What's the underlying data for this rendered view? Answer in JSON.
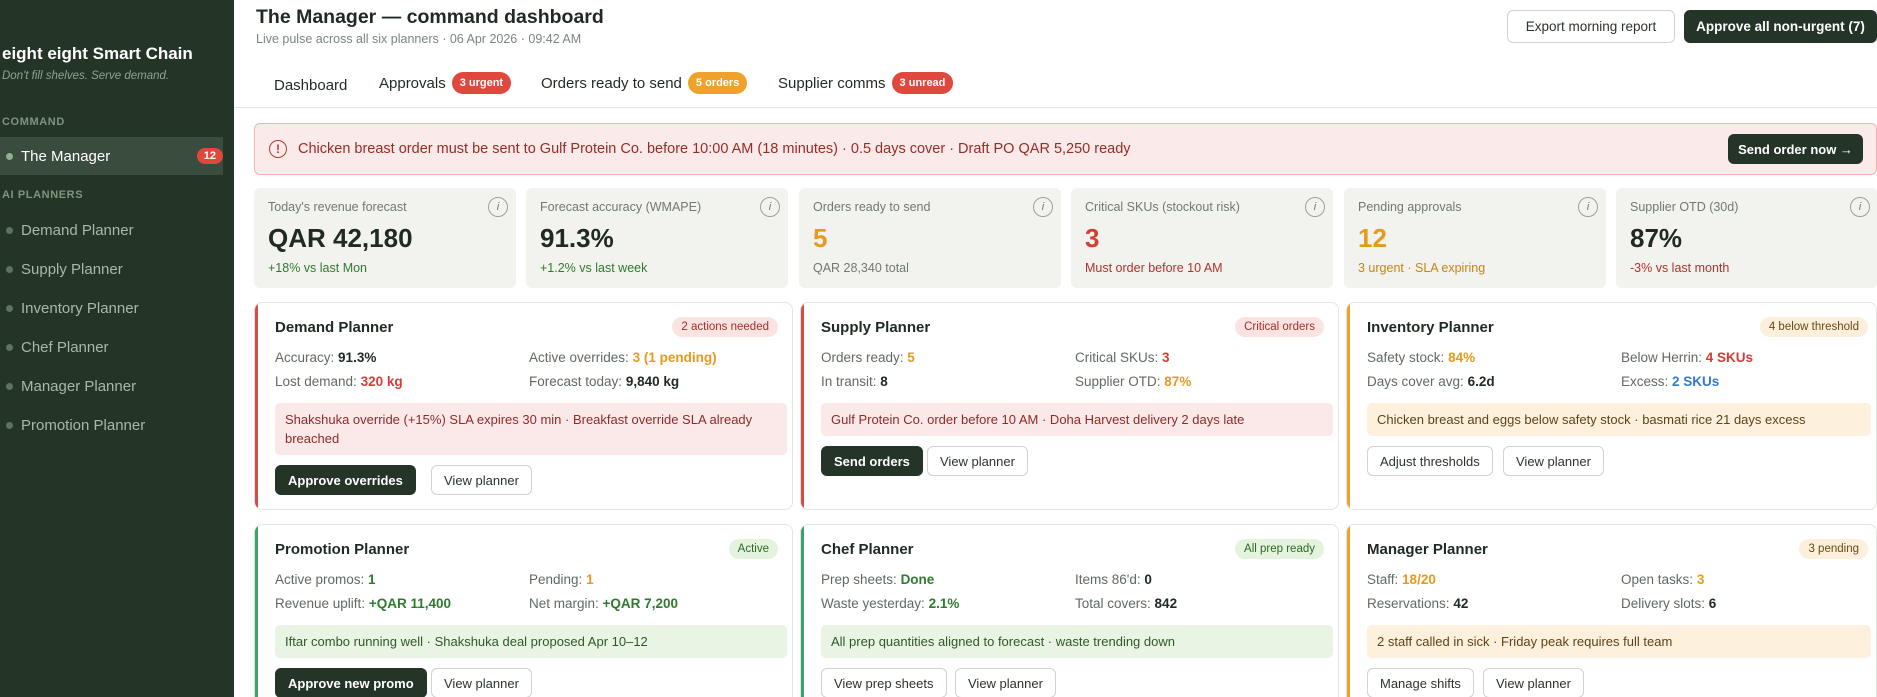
{
  "sidebar": {
    "brand": "eight eight Smart Chain",
    "tagline": "Don't fill shelves. Serve demand.",
    "section_command": "COMMAND",
    "section_planners": "AI PLANNERS",
    "manager": {
      "label": "The Manager",
      "count": "12"
    },
    "items": [
      {
        "label": "Demand Planner"
      },
      {
        "label": "Supply Planner"
      },
      {
        "label": "Inventory Planner"
      },
      {
        "label": "Chef Planner"
      },
      {
        "label": "Manager Planner"
      },
      {
        "label": "Promotion Planner"
      }
    ]
  },
  "header": {
    "title": "The Manager — command dashboard",
    "subtitle": "Live pulse across all six planners · 06 Apr 2026 · 09:42 AM",
    "export_label": "Export morning report",
    "approve_label": "Approve all non-urgent (7)"
  },
  "tabs": [
    {
      "label": "Dashboard",
      "badge": ""
    },
    {
      "label": "Approvals",
      "badge": "3 urgent"
    },
    {
      "label": "Orders ready to send",
      "badge": "5 orders"
    },
    {
      "label": "Supplier comms",
      "badge": "3 unread"
    }
  ],
  "alert": {
    "text": "Chicken breast order must be sent to Gulf Protein Co. before 10:00 AM (18 minutes) · 0.5 days cover · Draft PO QAR 5,250 ready",
    "button": "Send order now →"
  },
  "kpis": [
    {
      "label": "Today's revenue forecast",
      "value": "QAR 42,180",
      "sub": "+18% vs last Mon",
      "value_color": "#1f2a22",
      "sub_color": "#2f7a2f"
    },
    {
      "label": "Forecast accuracy (WMAPE)",
      "value": "91.3%",
      "sub": "+1.2% vs last week",
      "value_color": "#1f2a22",
      "sub_color": "#2f7a2f"
    },
    {
      "label": "Orders ready to send",
      "value": "5",
      "sub": "QAR 28,340 total",
      "value_color": "#e59a1d",
      "sub_color": "#6f7a70"
    },
    {
      "label": "Critical SKUs (stockout risk)",
      "value": "3",
      "sub": "Must order before 10 AM",
      "value_color": "#d43c34",
      "sub_color": "#b0322b"
    },
    {
      "label": "Pending approvals",
      "value": "12",
      "sub": "3 urgent · SLA expiring",
      "value_color": "#e59a1d",
      "sub_color": "#c88413"
    },
    {
      "label": "Supplier OTD (30d)",
      "value": "87%",
      "sub": "-3% vs last month",
      "value_color": "#1f2a22",
      "sub_color": "#b0322b"
    }
  ],
  "cards": {
    "demand": {
      "title": "Demand Planner",
      "badge": "2 actions needed",
      "s1_label": "Accuracy:",
      "s1_value": "91.3%",
      "s2_label": "Active overrides:",
      "s2_value": "3 (1 pending)",
      "s3_label": "Lost demand:",
      "s3_value": "320 kg",
      "s4_label": "Forecast today:",
      "s4_value": "9,840 kg",
      "note": "Shakshuka override (+15%) SLA expires 30 min · Breakfast override SLA already breached",
      "btn1": "Approve overrides",
      "btn2": "View planner"
    },
    "supply": {
      "title": "Supply Planner",
      "badge": "Critical orders",
      "s1_label": "Orders ready:",
      "s1_value": "5",
      "s2_label": "Critical SKUs:",
      "s2_value": "3",
      "s3_label": "In transit:",
      "s3_value": "8",
      "s4_label": "Supplier OTD:",
      "s4_value": "87%",
      "note": "Gulf Protein Co. order before 10 AM · Doha Harvest delivery 2 days late",
      "btn1": "Send orders",
      "btn2": "View planner"
    },
    "inventory": {
      "title": "Inventory Planner",
      "badge": "4 below threshold",
      "s1_label": "Safety stock:",
      "s1_value": "84%",
      "s2_label": "Below Herrin:",
      "s2_value": "4 SKUs",
      "s3_label": "Days cover avg:",
      "s3_value": "6.2d",
      "s4_label": "Excess:",
      "s4_value": "2 SKUs",
      "note": "Chicken breast and eggs below safety stock · basmati rice 21 days excess",
      "btn1": "Adjust thresholds",
      "btn2": "View planner"
    },
    "promotion": {
      "title": "Promotion Planner",
      "badge": "Active",
      "s1_label": "Active promos:",
      "s1_value": "1",
      "s2_label": "Pending:",
      "s2_value": "1",
      "s3_label": "Revenue uplift:",
      "s3_value": "+QAR 11,400",
      "s4_label": "Net margin:",
      "s4_value": "+QAR 7,200",
      "note": "Iftar combo running well · Shakshuka deal proposed Apr 10–12",
      "btn1": "Approve new promo",
      "btn2": "View planner"
    },
    "chef": {
      "title": "Chef Planner",
      "badge": "All prep ready",
      "s1_label": "Prep sheets:",
      "s1_value": "Done",
      "s2_label": "Items 86'd:",
      "s2_value": "0",
      "s3_label": "Waste yesterday:",
      "s3_value": "2.1%",
      "s4_label": "Total covers:",
      "s4_value": "842",
      "note": "All prep quantities aligned to forecast · waste trending down",
      "btn1": "View prep sheets",
      "btn2": "View planner"
    },
    "manager": {
      "title": "Manager Planner",
      "badge": "3 pending",
      "s1_label": "Staff:",
      "s1_value": "18/20",
      "s2_label": "Open tasks:",
      "s2_value": "3",
      "s3_label": "Reservations:",
      "s3_value": "42",
      "s4_label": "Delivery slots:",
      "s4_value": "6",
      "note": "2 staff called in sick · Friday peak requires full team",
      "btn1": "Manage shifts",
      "btn2": "View planner"
    }
  }
}
